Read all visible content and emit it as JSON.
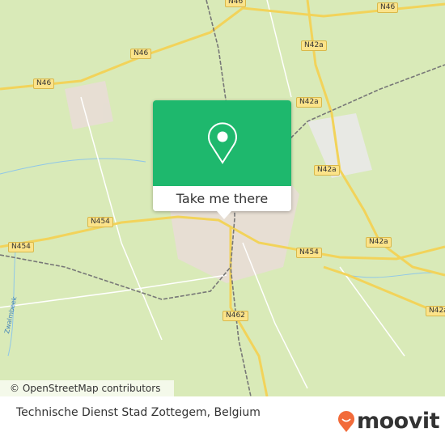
{
  "map": {
    "road_labels": [
      {
        "label": "N46"
      },
      {
        "label": "N46"
      },
      {
        "label": "N46"
      },
      {
        "label": "N46"
      },
      {
        "label": "N42a"
      },
      {
        "label": "N42a"
      },
      {
        "label": "N42a"
      },
      {
        "label": "N42a"
      },
      {
        "label": "N42a"
      },
      {
        "label": "N454"
      },
      {
        "label": "N454"
      },
      {
        "label": "N454"
      },
      {
        "label": "N462"
      }
    ],
    "river_label": "Zwalmbeek",
    "attribution": "© OpenStreetMap contributors"
  },
  "popup": {
    "icon": "map-pin-icon",
    "button_label": "Take me there",
    "color": "#1eb86d"
  },
  "footer": {
    "title": "Technische Dienst Stad Zottegem, Belgium",
    "logo_text": "moovit",
    "logo_color": "#f26b3a"
  }
}
